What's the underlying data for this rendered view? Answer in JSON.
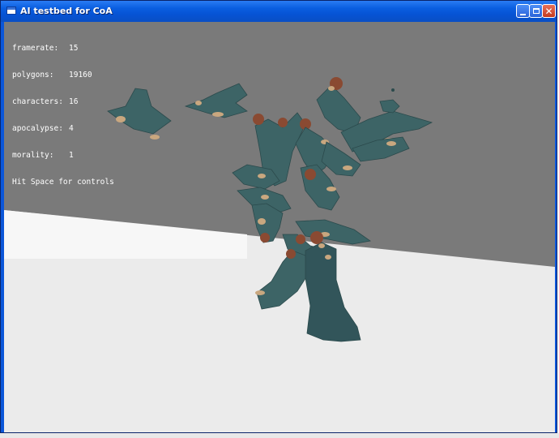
{
  "window": {
    "title": "AI testbed for CoA",
    "icon": "window-app-icon",
    "controls": {
      "minimize_icon": "minimize-icon",
      "maximize_icon": "maximize-icon",
      "close_icon": "close-icon",
      "close_glyph": "✕"
    }
  },
  "hud": {
    "stats": [
      {
        "label": "framerate:",
        "value": "15"
      },
      {
        "label": "polygons:",
        "value": "19160"
      },
      {
        "label": "characters:",
        "value": "16"
      },
      {
        "label": "apocalypse:",
        "value": "4"
      },
      {
        "label": "morality:",
        "value": "1"
      }
    ],
    "hint": "Hit Space for controls"
  },
  "colors": {
    "titlebar": "#0a5ee0",
    "sky": "#7a7a7a",
    "floor": "#ebebeb",
    "character_body": "#3d6466",
    "character_hair": "#8a4a32",
    "character_skin": "#c9a77f",
    "hud_text": "#ffffff"
  }
}
